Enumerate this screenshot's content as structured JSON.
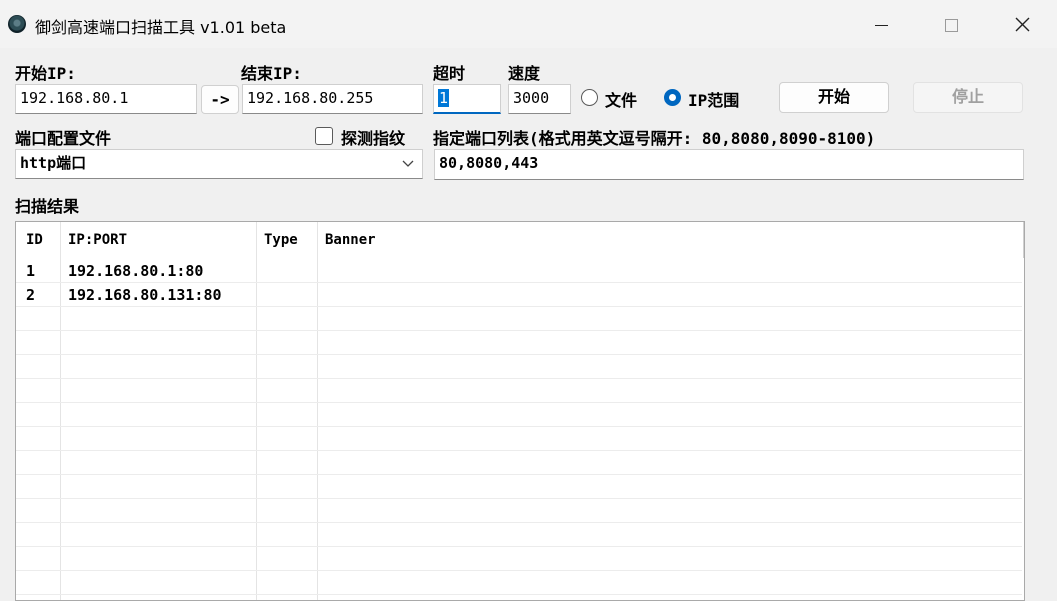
{
  "window": {
    "title": "御剑高速端口扫描工具 v1.01 beta",
    "icons": {
      "app": "app-icon",
      "minimize": "minimize-icon",
      "maximize": "maximize-icon",
      "close": "close-icon"
    }
  },
  "form": {
    "start_ip_label": "开始IP:",
    "start_ip_value": "192.168.80.1",
    "arrow_button": "->",
    "end_ip_label": "结束IP:",
    "end_ip_value": "192.168.80.255",
    "timeout_label": "超时",
    "timeout_value": "1",
    "speed_label": "速度",
    "speed_value": "3000",
    "mode_file_label": "文件",
    "mode_range_label": "IP范围",
    "mode_selected": "IP范围",
    "start_button": "开始",
    "stop_button": "停止",
    "port_config_label": "端口配置文件",
    "port_config_value": "http端口",
    "probe_fingerprint_label": "探测指纹",
    "probe_fingerprint_checked": false,
    "port_list_label": "指定端口列表(格式用英文逗号隔开: 80,8080,8090-8100)",
    "port_list_value": "80,8080,443"
  },
  "results": {
    "section_label": "扫描结果",
    "columns": [
      "ID",
      "IP:PORT",
      "Type",
      "Banner"
    ],
    "rows": [
      {
        "id": "1",
        "ip_port": "192.168.80.1:80",
        "type": "",
        "banner": ""
      },
      {
        "id": "2",
        "ip_port": "192.168.80.131:80",
        "type": "",
        "banner": ""
      }
    ]
  },
  "colors": {
    "accent": "#0067c0",
    "selection": "#0078d7"
  }
}
